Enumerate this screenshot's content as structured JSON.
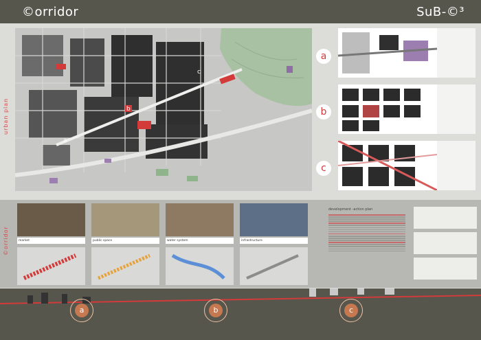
{
  "header": {
    "title_left": "©orridor",
    "title_right": "SuB-©³"
  },
  "urban_plan": {
    "side_label": "urban plan",
    "map_markers": [
      "a",
      "b",
      "c"
    ]
  },
  "details": {
    "labels": [
      "a",
      "b",
      "c"
    ]
  },
  "corridor_section": {
    "side_label": "©orridor",
    "photos": [
      {
        "caption": "market"
      },
      {
        "caption": "public space"
      },
      {
        "caption": "water system"
      },
      {
        "caption": "infrastructure"
      }
    ],
    "text_heading": "development -action plan"
  },
  "bottom_markers": [
    "a",
    "b",
    "c"
  ],
  "colors": {
    "header": "#57564d",
    "accent": "#d33a3a",
    "background": "#dcdcd8"
  }
}
